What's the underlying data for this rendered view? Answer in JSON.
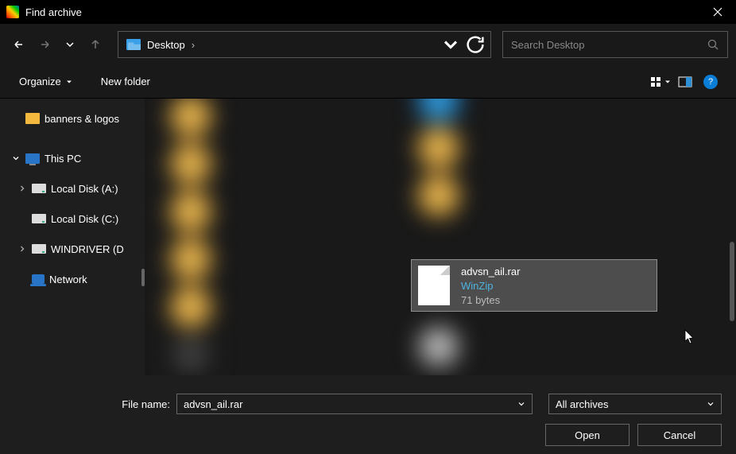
{
  "titlebar": {
    "title": "Find archive"
  },
  "nav": {
    "current_location": "Desktop"
  },
  "search": {
    "placeholder": "Search Desktop"
  },
  "toolbar": {
    "organize": "Organize",
    "new_folder": "New folder"
  },
  "sidebar": {
    "folder1": "banners & logos",
    "this_pc": "This PC",
    "diskA": "Local Disk (A:)",
    "diskC": "Local Disk (C:)",
    "windriver": "WINDRIVER (D",
    "network": "Network"
  },
  "selected_file": {
    "name": "advsn_ail.rar",
    "type": "WinZip",
    "size": "71 bytes"
  },
  "footer": {
    "filename_label": "File name:",
    "filename_value": "advsn_ail.rar",
    "filter": "All archives",
    "open": "Open",
    "cancel": "Cancel"
  }
}
